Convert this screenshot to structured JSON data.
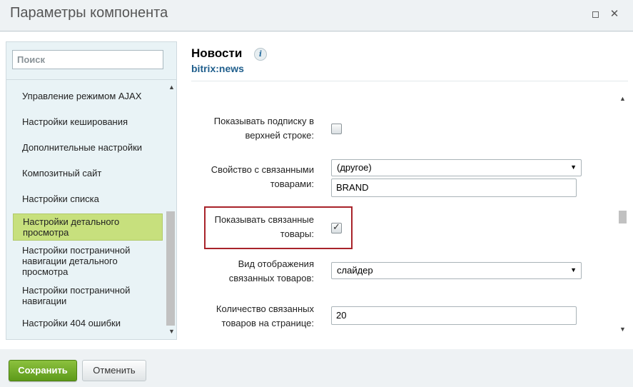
{
  "window": {
    "title": "Параметры компонента",
    "minimize_glyph": "☐",
    "close_glyph": "✕"
  },
  "sidebar": {
    "search_placeholder": "Поиск",
    "items": [
      {
        "label": "Управление режимом AJAX",
        "active": false
      },
      {
        "label": "Настройки кеширования",
        "active": false
      },
      {
        "label": "Дополнительные настройки",
        "active": false
      },
      {
        "label": "Композитный сайт",
        "active": false
      },
      {
        "label": "Настройки списка",
        "active": false
      },
      {
        "label": "Настройки детального просмотра",
        "active": true
      },
      {
        "label": "Настройки постраничной навигации детального просмотра",
        "active": false
      },
      {
        "label": "Настройки постраничной навигации",
        "active": false
      },
      {
        "label": "Настройки 404 ошибки",
        "active": false
      }
    ]
  },
  "main": {
    "title": "Новости",
    "info_glyph": "i",
    "component_code": "bitrix:news",
    "fields": [
      {
        "label_line1": "Показывать подписку в",
        "label_line2": "верхней строке:",
        "type": "checkbox",
        "checked": false
      },
      {
        "label_line1": "Свойство с связанными",
        "label_line2": "товарами:",
        "type": "select+text",
        "select_value": "(другое)",
        "text_value": "BRAND"
      },
      {
        "label_line1": "Показывать связанные",
        "label_line2": "товары:",
        "type": "checkbox",
        "checked": true,
        "highlighted": true
      },
      {
        "label_line1": "Вид отображения",
        "label_line2": "связанных товаров:",
        "type": "select",
        "select_value": "слайдер"
      },
      {
        "label_line1": "Количество связанных",
        "label_line2": "товаров на странице:",
        "type": "text",
        "text_value": "20"
      }
    ]
  },
  "footer": {
    "save_label": "Сохранить",
    "cancel_label": "Отменить"
  },
  "colors": {
    "accent_green": "#6aa823",
    "active_item": "#c7e07d",
    "highlight_border": "#a8232a",
    "link_blue": "#1f5e8c"
  }
}
